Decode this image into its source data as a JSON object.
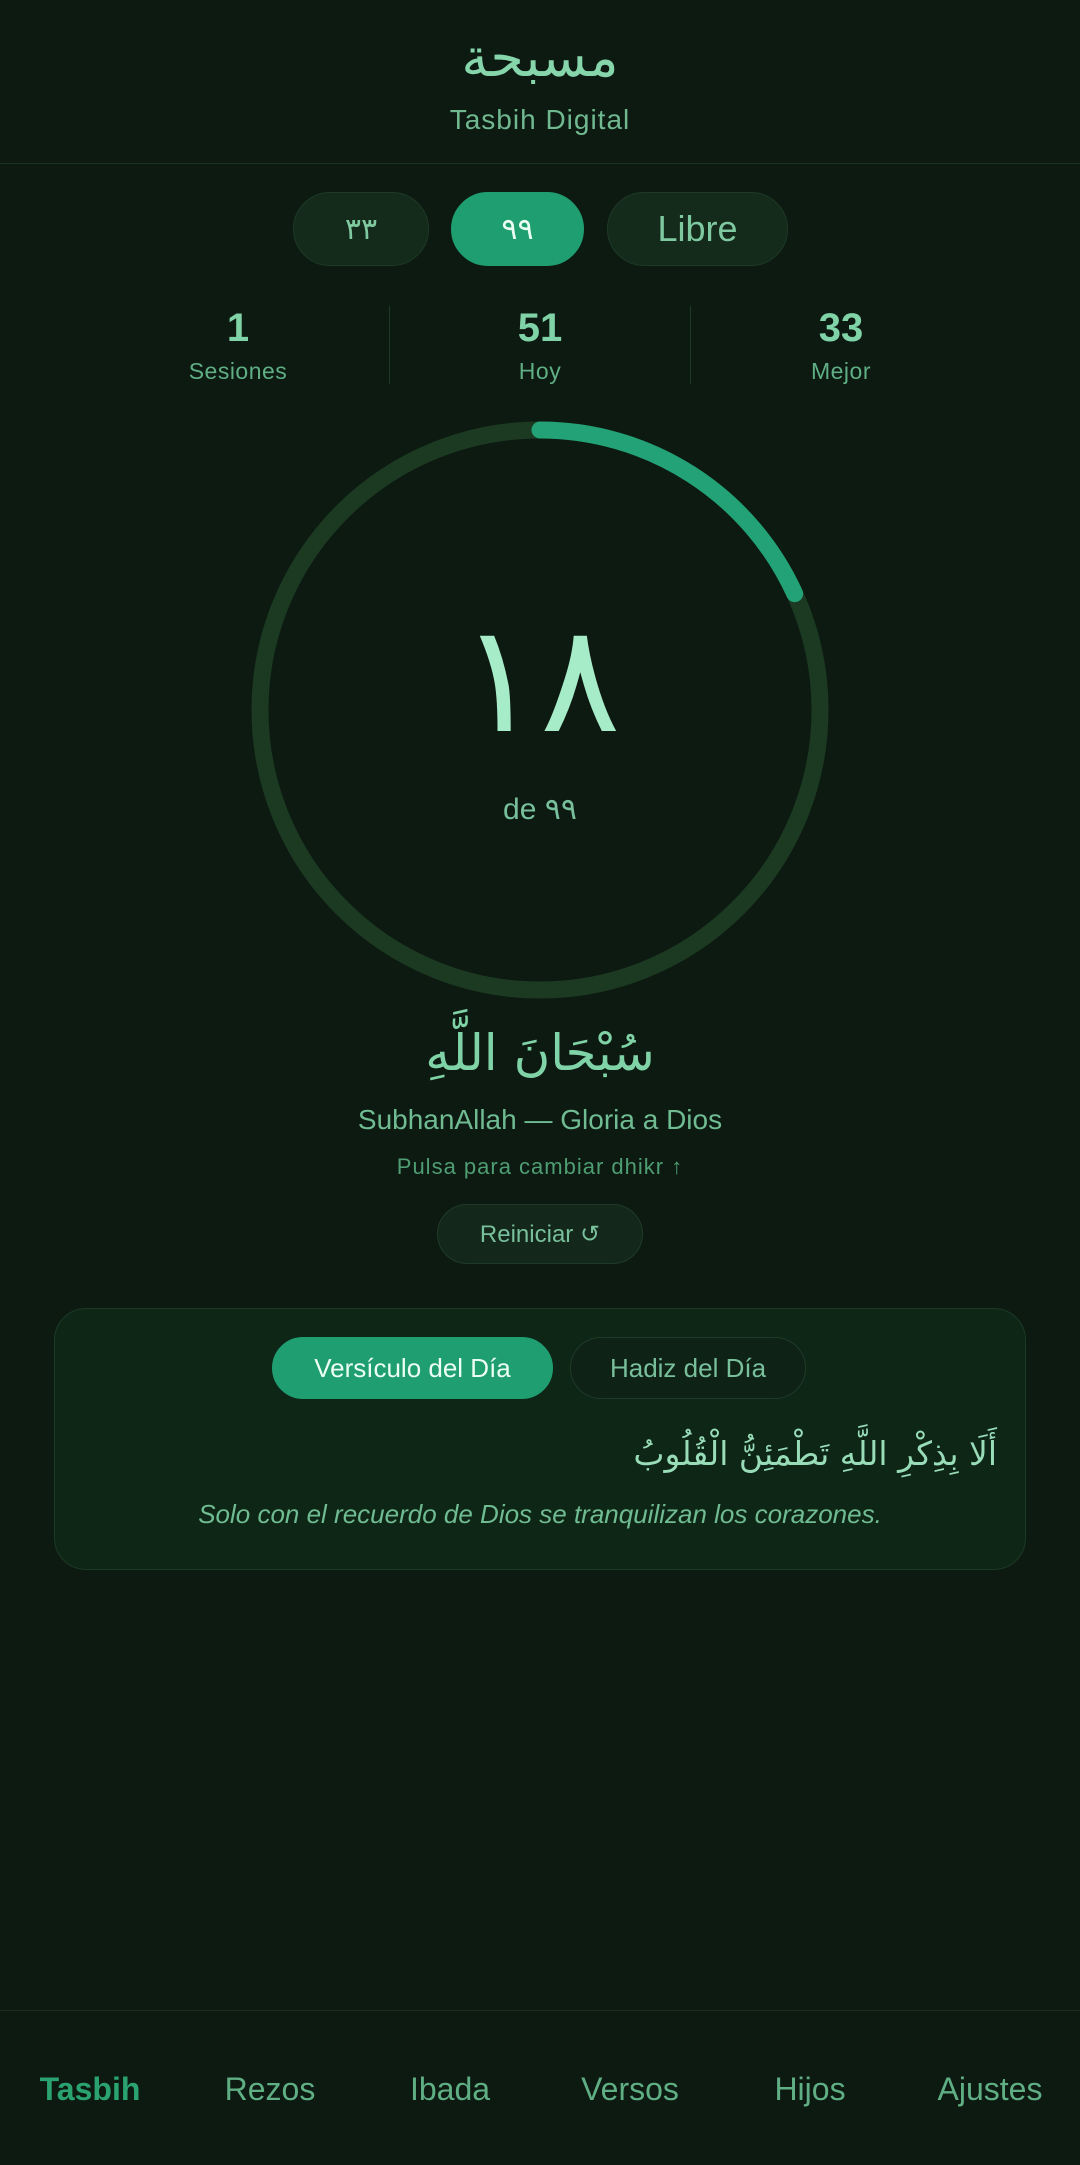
{
  "header": {
    "title": "مسبحة",
    "subtitle": "Tasbih Digital"
  },
  "modes": [
    {
      "label": "٣٣",
      "active": false
    },
    {
      "label": "٩٩",
      "active": true
    },
    {
      "label": "Libre",
      "active": false
    }
  ],
  "stats": [
    {
      "value": "1",
      "label": "Sesiones"
    },
    {
      "value": "51",
      "label": "Hoy"
    },
    {
      "value": "33",
      "label": "Mejor"
    }
  ],
  "counter": {
    "value": "١٨",
    "target_label": "de ٩٩",
    "progress": 0.1818,
    "track_color": "#1c3a22",
    "progress_color": "#22a276"
  },
  "dhikr": {
    "arabic": "سُبْحَانَ اللَّهِ",
    "translation": "SubhanAllah — Gloria a Dios",
    "hint": "Pulsa para cambiar dhikr ↑"
  },
  "reset": {
    "label": "Reiniciar ↺"
  },
  "verse_card": {
    "tabs": [
      {
        "label": "Versículo del Día",
        "active": true
      },
      {
        "label": "Hadiz del Día",
        "active": false
      }
    ],
    "arabic": "أَلَا بِذِكْرِ اللَّهِ تَطْمَئِنُّ الْقُلُوبُ",
    "translation": "Solo con el recuerdo de Dios se tranquilizan los corazones."
  },
  "nav": {
    "items": [
      {
        "label": "Tasbih",
        "active": true
      },
      {
        "label": "Rezos",
        "active": false
      },
      {
        "label": "Ibada",
        "active": false
      },
      {
        "label": "Versos",
        "active": false
      },
      {
        "label": "Hijos",
        "active": false
      },
      {
        "label": "Ajustes",
        "active": false
      }
    ]
  },
  "colors": {
    "background": "#0c1a11",
    "accent": "#1f9e72",
    "text": "#7fc9a0"
  }
}
